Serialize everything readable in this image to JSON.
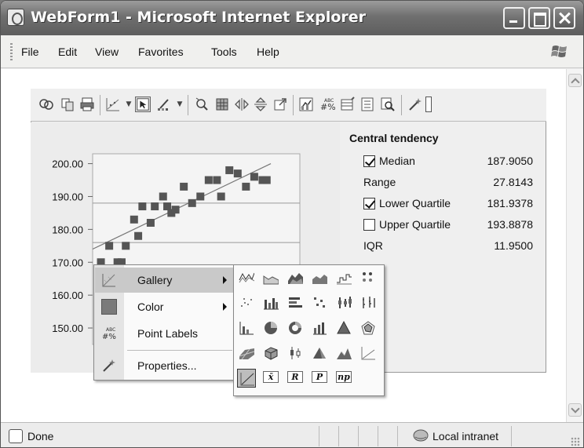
{
  "window": {
    "title": "WebForm1 - Microsoft Internet Explorer"
  },
  "menubar": {
    "items": [
      "File",
      "Edit",
      "View",
      "Favorites",
      "Tools",
      "Help"
    ]
  },
  "toolbar": {
    "icons": [
      "copy-data-icon",
      "copy-icon",
      "print-icon",
      "chart-type-icon",
      "pointer-icon",
      "color-brush-icon",
      "zoom-icon",
      "data-grid-icon",
      "move-horizontal-icon",
      "move-vertical-icon",
      "export-icon",
      "gallery-icon",
      "point-labels-icon",
      "data-editor-icon",
      "legend-icon",
      "properties-zoom-icon",
      "properties-icon"
    ]
  },
  "chart": {
    "y_ticks": [
      "200.00",
      "190.00",
      "180.00",
      "170.00",
      "160.00",
      "150.00"
    ]
  },
  "chart_data": {
    "type": "scatter",
    "ylim": [
      145,
      203
    ],
    "xlim": [
      0,
      25
    ],
    "y_tick_values": [
      200,
      190,
      180,
      170,
      160,
      150
    ],
    "x": [
      1,
      2,
      3,
      3.5,
      4,
      5,
      5.5,
      6,
      7,
      7.5,
      8.5,
      9,
      9.5,
      10,
      11,
      12,
      13,
      14,
      15,
      15.5,
      16.5,
      17.5,
      18.5,
      19.5,
      20.5,
      21
    ],
    "y": [
      170,
      175,
      170,
      170,
      175,
      183,
      178,
      187,
      182,
      187,
      190,
      187,
      185,
      186,
      193,
      188,
      190,
      195,
      195,
      190,
      198,
      197,
      193,
      196,
      195,
      195
    ],
    "series": [
      {
        "name": "",
        "role": "points",
        "color": "#555555"
      }
    ],
    "reference_lines": [
      188,
      176
    ],
    "trend_line": {
      "from": [
        0,
        174
      ],
      "to": [
        21.5,
        200
      ]
    },
    "grid": false
  },
  "stats": {
    "title": "Central tendency",
    "rows": [
      {
        "label": "Median",
        "value": "187.9050",
        "checkbox": true,
        "checked": true
      },
      {
        "label": "Range",
        "value": "27.8143",
        "checkbox": false
      },
      {
        "label": "Lower Quartile",
        "value": "181.9378",
        "checkbox": true,
        "checked": true
      },
      {
        "label": "Upper Quartile",
        "value": "193.8878",
        "checkbox": true,
        "checked": false
      },
      {
        "label": "IQR",
        "value": "11.9500",
        "checkbox": false
      }
    ]
  },
  "context_menu": {
    "items": [
      {
        "label": "Gallery",
        "submenu": true,
        "highlighted": true,
        "icon": "gallery-icon"
      },
      {
        "label": "Color",
        "submenu": true,
        "icon": "color-swatch-icon"
      },
      {
        "label": "Point Labels",
        "submenu": false,
        "icon": "point-labels-icon"
      },
      {
        "label": "Properties...",
        "submenu": false,
        "icon": "properties-icon"
      }
    ]
  },
  "gallery": {
    "rows": [
      [
        "line-chart-icon",
        "area-line-icon",
        "area-3d-icon",
        "area-chart-icon",
        "step-chart-icon",
        "scatter-dots-icon"
      ],
      [
        "scatter-sparse-icon",
        "bar-chart-icon",
        "horizontal-bar-icon",
        "scatter-grid-icon",
        "hilow-icon",
        "hilow-close-icon"
      ],
      [
        "bar-axis-icon",
        "pie-chart-icon",
        "doughnut-chart-icon",
        "bar-3d-icon",
        "pyramid-icon",
        "radar-chart-icon"
      ],
      [
        "surface-icon",
        "cube-icon",
        "candlestick-icon",
        "pyramid-3d-icon",
        "mountain-icon",
        "trend-line-icon"
      ],
      [
        "scatter-trend-icon",
        "xbar-chart-icon",
        "r-chart-icon",
        "p-chart-icon",
        "np-chart-icon"
      ]
    ],
    "text_cells": [
      "x̄",
      "R",
      "P",
      "np"
    ]
  },
  "statusbar": {
    "text": "Done",
    "zone": "Local intranet"
  }
}
